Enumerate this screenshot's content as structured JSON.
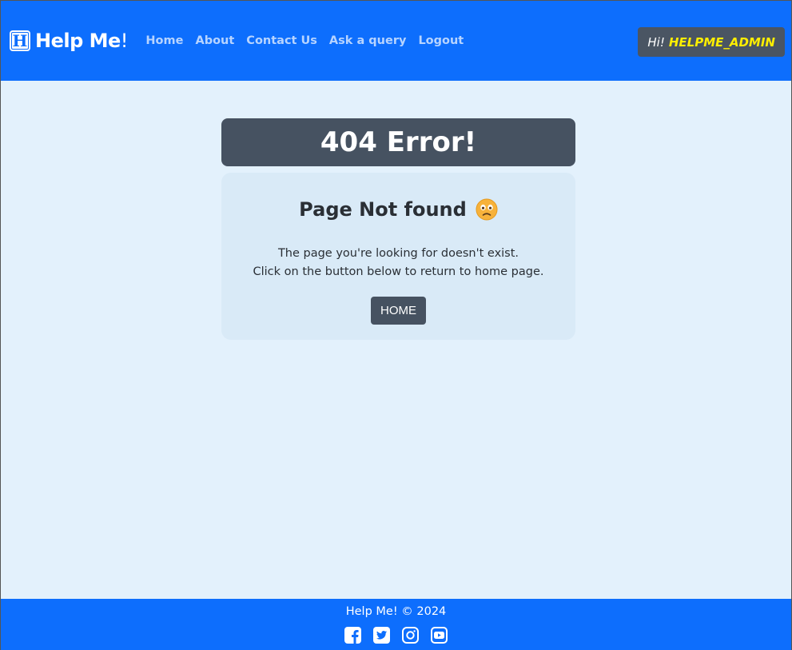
{
  "brand": {
    "name": "Help Me",
    "exclaim": "!"
  },
  "nav": {
    "items": [
      "Home",
      "About",
      "Contact Us",
      "Ask a query",
      "Logout"
    ]
  },
  "user": {
    "greeting": "Hi!",
    "username": "HELPME_ADMIN"
  },
  "error": {
    "title": "404 Error!",
    "subtitle": "Page Not found",
    "line1": "The page you're looking for doesn't exist.",
    "line2": "Click on the button below to return to home page.",
    "button": "HOME"
  },
  "footer": {
    "copyright": "Help Me! © 2024",
    "social_icons": [
      "facebook-icon",
      "twitter-icon",
      "instagram-icon",
      "youtube-icon"
    ]
  },
  "colors": {
    "primary": "#0d6efd",
    "dark": "#465261",
    "username": "#ffee00",
    "background": "#e3f1fc",
    "card": "#d9eaf7"
  }
}
